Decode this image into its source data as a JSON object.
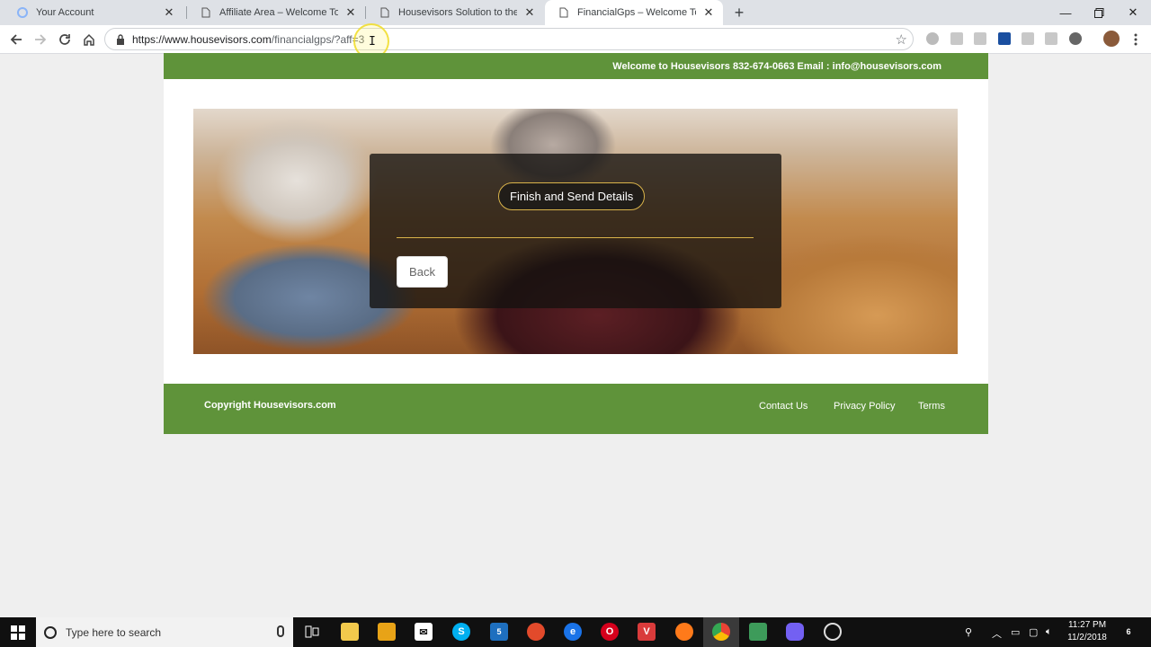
{
  "browser": {
    "tabs": [
      {
        "title": "Your Account",
        "active": false
      },
      {
        "title": "Affiliate Area – Welcome To Housevisors",
        "active": false
      },
      {
        "title": "Housevisors Solution to the Retirement",
        "active": false
      },
      {
        "title": "FinancialGps – Welcome To Housevisors",
        "active": true
      }
    ],
    "url_host": "https://www.housevisors.com",
    "url_path": "/financialgps/?aff=3"
  },
  "header": {
    "welcome_text": "Welcome to Housevisors 832-674-0663 Email : info@housevisors.com"
  },
  "form": {
    "finish_label": "Finish and Send Details",
    "back_label": "Back"
  },
  "footer": {
    "copyright": "Copyright Housevisors.com",
    "links": [
      "Contact Us",
      "Privacy Policy",
      "Terms"
    ]
  },
  "taskbar": {
    "search_placeholder": "Type here to search",
    "mail_badge": "5",
    "time": "11:27 PM",
    "date": "11/2/2018",
    "notification_count": "6"
  },
  "colors": {
    "brand_green": "#5f933a",
    "accent_gold": "#d9b34a"
  }
}
